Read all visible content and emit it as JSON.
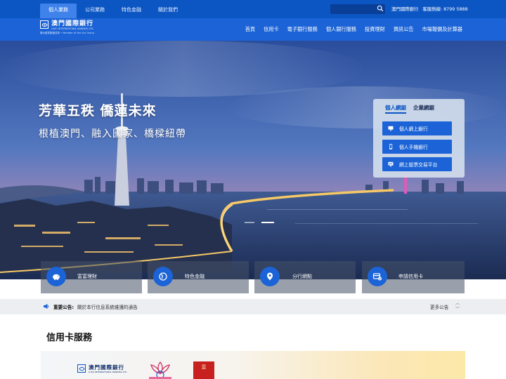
{
  "top_tabs": [
    "個人業務",
    "公司業務",
    "特色金融",
    "關於我們"
  ],
  "top_right": {
    "bank_label": "澳門國際銀行",
    "hotline_label": "客服熱線",
    "hotline_number": "8799 5888"
  },
  "logo": {
    "name_cn": "澳門國際銀行",
    "name_en": "LUSO INTERNATIONAL BANKING LTD.",
    "subtitle": "廣州越秀集團成員  • Member of Yue Xiu Group"
  },
  "main_nav": [
    "首頁",
    "信用卡",
    "電子銀行服務",
    "個人銀行服務",
    "投資理財",
    "資訊公告",
    "市場報價及計算器"
  ],
  "hero": {
    "title": "芳華五秩 僑蓮未來",
    "subtitle": "根植澳門、融入國家、橋樑紐帶"
  },
  "login_panel": {
    "tabs": [
      "個人網銀",
      "企業網銀"
    ],
    "buttons": [
      {
        "label": "個人網上銀行",
        "icon": "desktop-icon"
      },
      {
        "label": "個人手機銀行",
        "icon": "mobile-phone-icon"
      },
      {
        "label": "網上股票交易平台",
        "icon": "monitor-chart-icon"
      }
    ]
  },
  "quick_links": [
    {
      "label": "富富理財",
      "icon": "piggy-bank-icon"
    },
    {
      "label": "特色金融",
      "icon": "globe-icon"
    },
    {
      "label": "分行網點",
      "icon": "location-pin-icon"
    },
    {
      "label": "申請信用卡",
      "icon": "credit-card-icon"
    }
  ],
  "notice": {
    "label": "重要公告:",
    "text": "關於本行信息系統維護的通告",
    "more": "更多公告"
  },
  "section": {
    "title": "信用卡服務"
  },
  "card_banner": {
    "logo_cn": "澳門國際銀行",
    "logo_en": "LUSO INTERNATIONAL BANKING LTD.",
    "badge_text": "壹"
  },
  "colors": {
    "top_bar": "#0c56c4",
    "nav_bar": "#1b63d6",
    "button_blue": "#1b63d6",
    "notice_bg": "#eceef1"
  }
}
